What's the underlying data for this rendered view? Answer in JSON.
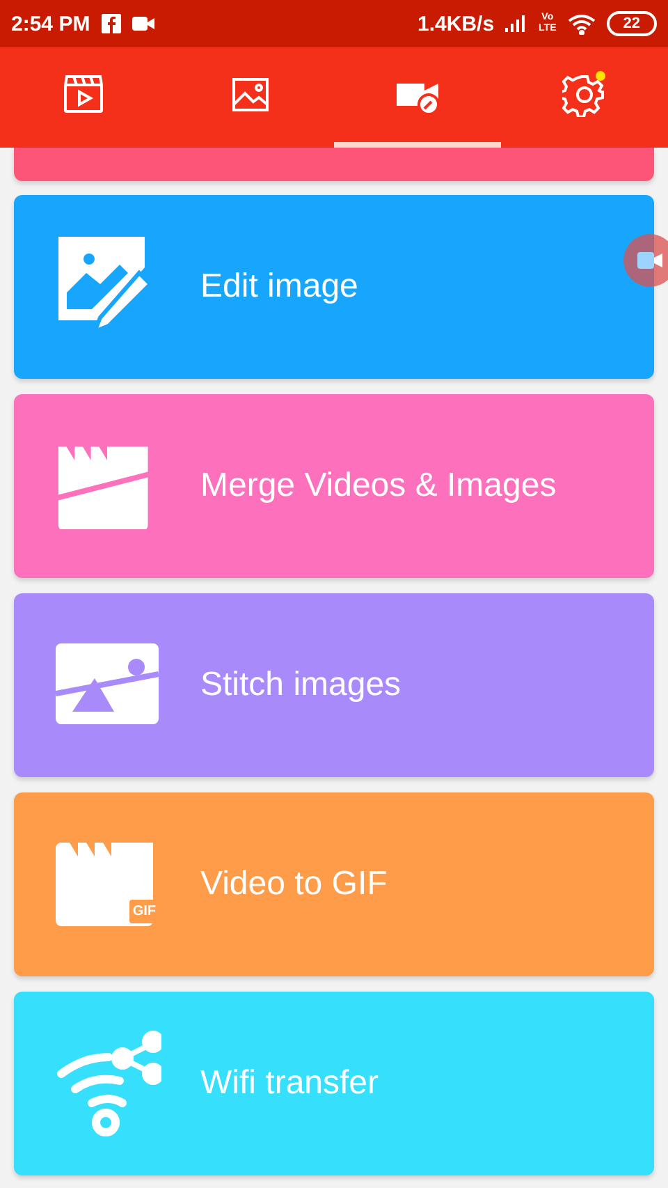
{
  "status_bar": {
    "time": "2:54 PM",
    "speed": "1.4KB/s",
    "volte_top": "Vo",
    "volte_bottom": "LTE",
    "battery": "22"
  },
  "tabs": [
    {
      "kind": "video",
      "selected": false,
      "badge": false
    },
    {
      "kind": "image",
      "selected": false,
      "badge": false
    },
    {
      "kind": "camera-edit",
      "selected": true,
      "badge": false
    },
    {
      "kind": "settings",
      "selected": false,
      "badge": true
    }
  ],
  "cards": [
    {
      "kind": "partial",
      "color": "#fd5577"
    },
    {
      "kind": "edit-image",
      "color": "#18a6fc",
      "label": "Edit image"
    },
    {
      "kind": "merge",
      "color": "#fd70bb",
      "label": "Merge Videos & Images"
    },
    {
      "kind": "stitch",
      "color": "#a98afb",
      "label": "Stitch images"
    },
    {
      "kind": "gif",
      "color": "#fe9c4a",
      "label": "Video to GIF",
      "badge": "GIF"
    },
    {
      "kind": "wifi",
      "color": "#36dffc",
      "label": "Wifi transfer"
    }
  ]
}
